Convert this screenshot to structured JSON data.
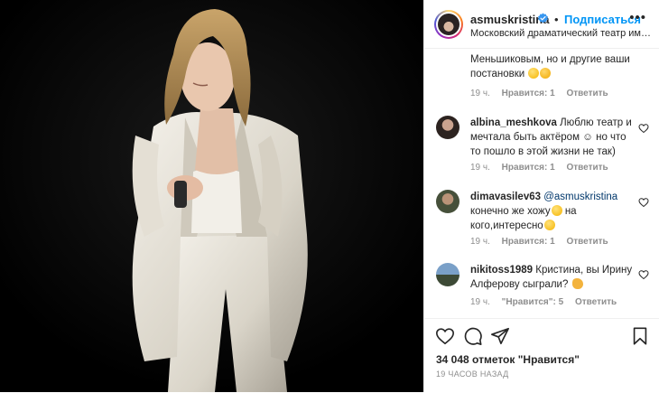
{
  "post": {
    "username": "asmuskristina",
    "follow_label": "Подписаться",
    "separator": "•",
    "location": "Московский драматический театр имени М...",
    "more_icon": "ellipsis-icon",
    "likes": "34 048 отметок \"Нравится\"",
    "time_ago": "19 ЧАСОВ НАЗАД"
  },
  "comments": [
    {
      "username": "",
      "text": "Меньшиковым, но и другие ваши постановки",
      "emoji": [
        "smiling-face-icon",
        "heart-eyes-icon"
      ],
      "time": "19 ч.",
      "likes_label": "Нравится: 1",
      "reply_label": "Ответить"
    },
    {
      "username": "albina_meshkova",
      "text": "Люблю театр и мечтала быть актёром ☺ но что то пошло в этой жизни не так)",
      "time": "19 ч.",
      "likes_label": "Нравится: 1",
      "reply_label": "Ответить"
    },
    {
      "username": "dimavasilev63",
      "mention": "@asmuskristina",
      "text": "конечно же хожу",
      "text2": "на кого,интересно",
      "time": "19 ч.",
      "likes_label": "Нравится: 1",
      "reply_label": "Ответить"
    },
    {
      "username": "nikitoss1989",
      "text": "Кристина, вы Ирину Алферову сыграли?",
      "time": "19 ч.",
      "likes_label": "\"Нравится\": 5",
      "reply_label": "Ответить"
    }
  ],
  "colors": {
    "accent": "#0095f6",
    "text": "#262626",
    "muted": "#8e8e8e",
    "border": "#efefef"
  },
  "icons": [
    "verified-badge-icon",
    "heart-icon",
    "comment-icon",
    "share-icon",
    "bookmark-icon"
  ]
}
